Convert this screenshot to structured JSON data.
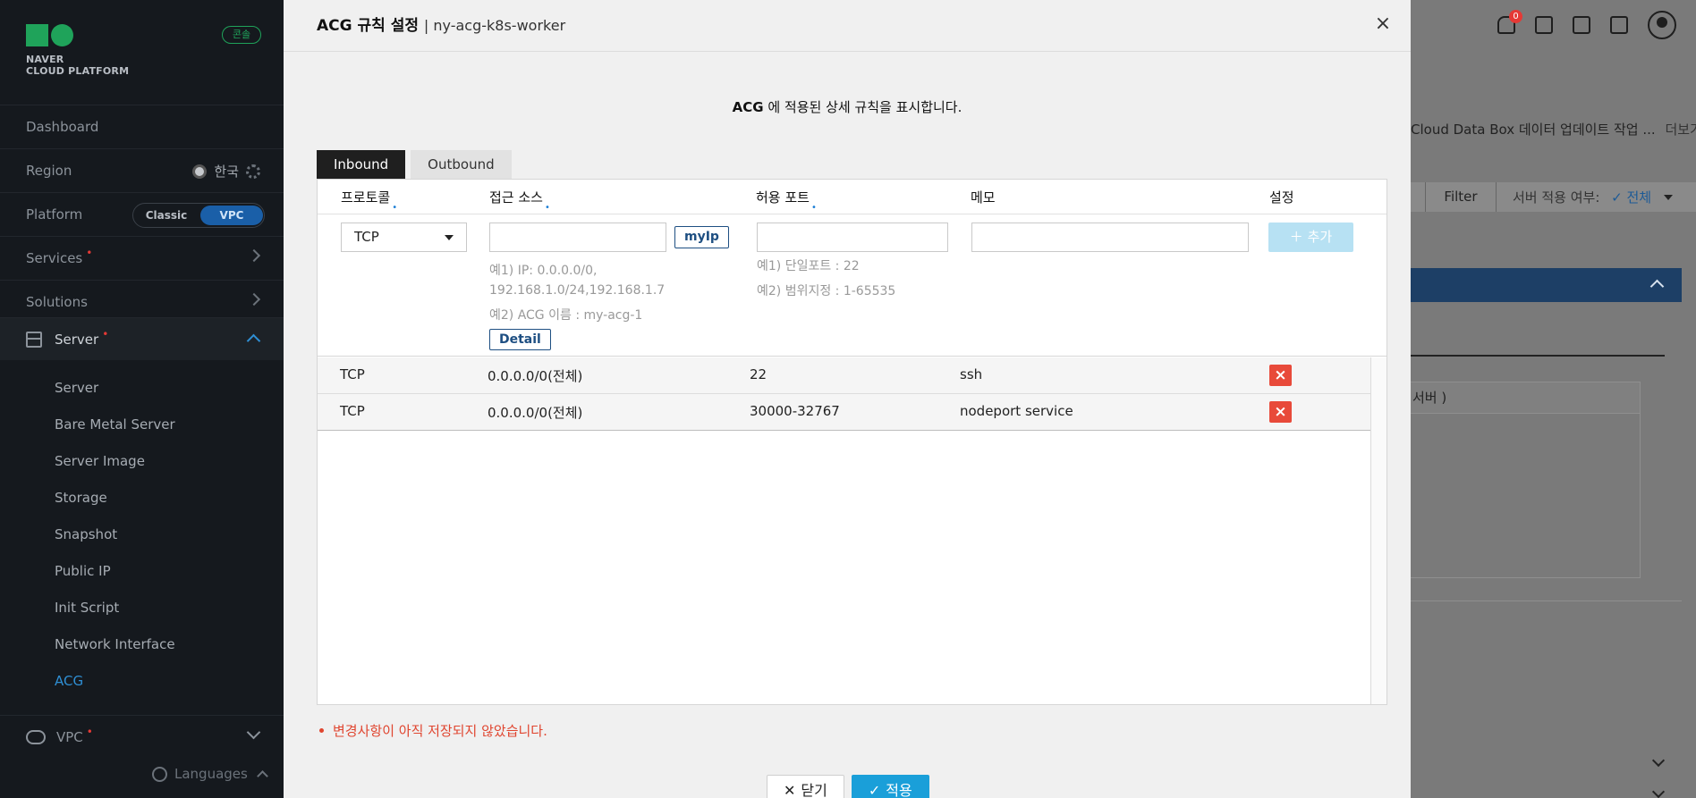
{
  "sidebar": {
    "brand_line1": "NAVER",
    "brand_line2": "CLOUD PLATFORM",
    "console_badge": "콘솔",
    "dashboard": "Dashboard",
    "region_label": "Region",
    "region_value": "한국",
    "platform_label": "Platform",
    "platform_options": [
      "Classic",
      "VPC"
    ],
    "platform_selected": "VPC",
    "services": "Services",
    "solutions": "Solutions",
    "server": "Server",
    "server_items": [
      "Server",
      "Bare Metal Server",
      "Server Image",
      "Storage",
      "Snapshot",
      "Public IP",
      "Init Script",
      "Network Interface",
      "ACG"
    ],
    "active_item": "ACG",
    "vpc": "VPC",
    "languages": "Languages",
    "dot": "•"
  },
  "background": {
    "notification_count": "0",
    "notice_text": "Cloud Data Box 데이터 업데이트 작업 ...",
    "notice_more": "더보기",
    "filter_label": "Filter",
    "server_apply_label": "서버 적용 여부:",
    "server_apply_value": "✓ 전체",
    "panel_title": "서버 )"
  },
  "modal": {
    "title": "ACG 규칙 설정",
    "subtitle": "| ny-acg-k8s-worker",
    "description_strong": "ACG",
    "description_rest": " 에 적용된 상세 규칙을 표시합니다.",
    "tabs": [
      "Inbound",
      "Outbound"
    ],
    "active_tab": "Inbound",
    "columns": {
      "protocol": "프로토콜",
      "source": "접근 소스",
      "port": "허용 포트",
      "memo": "메모",
      "settings": "설정"
    },
    "required_mark": "•",
    "form": {
      "protocol_value": "TCP",
      "source_value": "",
      "port_value": "",
      "memo_value": "",
      "myip_label": "myIp",
      "source_hint_1": "예1) IP: 0.0.0.0/0,",
      "source_hint_1b": "192.168.1.0/24,192.168.1.7",
      "source_hint_2": "예2) ACG 이름 : my-acg-1",
      "detail_label": "Detail",
      "port_hint_1": "예1) 단일포트 : 22",
      "port_hint_2": "예2) 범위지정 : 1-65535",
      "add_label": "추가"
    },
    "rules": [
      {
        "protocol": "TCP",
        "source": "0.0.0.0/0(전체)",
        "port": "22",
        "memo": "ssh"
      },
      {
        "protocol": "TCP",
        "source": "0.0.0.0/0(전체)",
        "port": "30000-32767",
        "memo": "nodeport service"
      }
    ],
    "warning": "변경사항이 아직 저장되지 않았습니다.",
    "close_label": "닫기",
    "apply_label": "적용"
  }
}
